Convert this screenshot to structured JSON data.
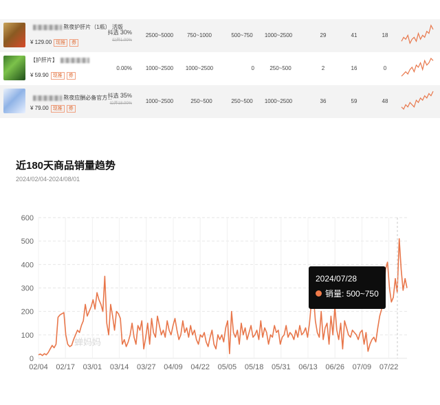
{
  "table": {
    "rows": [
      {
        "name": "熬夜护肝片（1瓶）",
        "name_extra": "活版",
        "price": "¥ 129.00",
        "tags": [
          "现推",
          "券"
        ],
        "rate": "30",
        "rate_prefix": "抖选",
        "rate_unit": "%",
        "rate_old": "公开1.00%",
        "sales": [
          "2500~5000",
          "750~1000",
          "500~750",
          "1000~2500"
        ],
        "counts": [
          "29",
          "41",
          "18"
        ],
        "spark": [
          4,
          6,
          5,
          7,
          3,
          5,
          6,
          4,
          8,
          5,
          7,
          6,
          9,
          8,
          12,
          10
        ]
      },
      {
        "name": "【护肝片】",
        "name_extra": "",
        "price": "¥ 59.90",
        "tags": [
          "现推",
          "券"
        ],
        "rate": "0.00%",
        "rate_prefix": "",
        "rate_unit": "",
        "rate_old": "",
        "sales": [
          "1000~2500",
          "1000~2500",
          "0",
          "250~500"
        ],
        "counts": [
          "2",
          "16",
          "0"
        ],
        "spark": [
          2,
          3,
          4,
          3,
          5,
          6,
          4,
          7,
          6,
          8,
          5,
          9,
          7,
          8,
          10,
          9
        ]
      },
      {
        "name": "熬夜应酬必备官方...",
        "name_extra": "",
        "price": "¥ 79.00",
        "tags": [
          "现推",
          "券"
        ],
        "rate": "35",
        "rate_prefix": "抖选",
        "rate_unit": "%",
        "rate_old": "公开18.00%",
        "sales": [
          "1000~2500",
          "250~500",
          "250~500",
          "1000~2500"
        ],
        "counts": [
          "36",
          "59",
          "48"
        ],
        "spark": [
          5,
          4,
          6,
          5,
          7,
          6,
          5,
          8,
          7,
          9,
          8,
          10,
          9,
          11,
          10,
          12
        ]
      }
    ]
  },
  "title": "近180天商品销量趋势",
  "date_range": "2024/02/04-2024/08/01",
  "tooltip": {
    "date": "2024/07/28",
    "label": "销量:",
    "value": "500~750"
  },
  "watermark": "蝉妈妈",
  "colors": {
    "line": "#e8764a",
    "grid": "#e6e6e6",
    "tooltip_bg": "#0d0d0d"
  },
  "chart_data": {
    "type": "line",
    "title": "近180天商品销量趋势",
    "xlabel": "",
    "ylabel": "",
    "ylim": [
      0,
      600
    ],
    "yticks": [
      0,
      100,
      200,
      300,
      400,
      500,
      600
    ],
    "xticks": [
      "02/04",
      "02/17",
      "03/01",
      "03/14",
      "03/27",
      "04/09",
      "04/22",
      "05/05",
      "05/18",
      "05/31",
      "06/13",
      "06/26",
      "07/09",
      "07/22"
    ],
    "grid": true,
    "legend": "none",
    "x_start": "2024/02/04",
    "x_end": "2024/08/01",
    "highlight_x": "2024/07/28",
    "series": [
      {
        "name": "销量",
        "values": [
          15,
          18,
          12,
          20,
          15,
          25,
          40,
          55,
          45,
          60,
          175,
          185,
          190,
          195,
          100,
          60,
          50,
          55,
          80,
          100,
          120,
          110,
          140,
          160,
          230,
          180,
          200,
          220,
          250,
          210,
          280,
          250,
          230,
          200,
          350,
          150,
          100,
          230,
          180,
          120,
          200,
          190,
          170,
          60,
          80,
          50,
          70,
          100,
          150,
          90,
          60,
          140,
          120,
          160,
          40,
          90,
          150,
          60,
          170,
          110,
          90,
          180,
          140,
          100,
          120,
          90,
          160,
          120,
          100,
          140,
          170,
          120,
          80,
          100,
          160,
          110,
          130,
          90,
          140,
          100,
          120,
          80,
          60,
          100,
          90,
          110,
          70,
          50,
          90,
          120,
          60,
          40,
          100,
          80,
          100,
          70,
          130,
          160,
          20,
          200,
          110,
          90,
          120,
          60,
          150,
          100,
          130,
          80,
          110,
          140,
          90,
          100,
          120,
          80,
          160,
          90,
          130,
          110,
          60,
          100,
          90,
          140,
          110,
          120,
          60,
          90,
          100,
          140,
          90,
          110,
          100,
          80,
          120,
          90,
          140,
          100,
          110,
          130,
          90,
          150,
          240,
          270,
          160,
          110,
          90,
          200,
          80,
          130,
          150,
          60,
          180,
          100,
          220,
          120,
          80,
          150,
          40,
          160,
          130,
          100,
          90,
          120,
          110,
          100,
          80,
          110,
          120,
          60,
          110,
          30,
          60,
          80,
          90,
          70,
          130,
          180,
          210,
          260,
          380,
          410,
          300,
          240,
          260,
          340,
          280,
          510,
          380,
          290,
          340,
          300
        ]
      }
    ]
  }
}
